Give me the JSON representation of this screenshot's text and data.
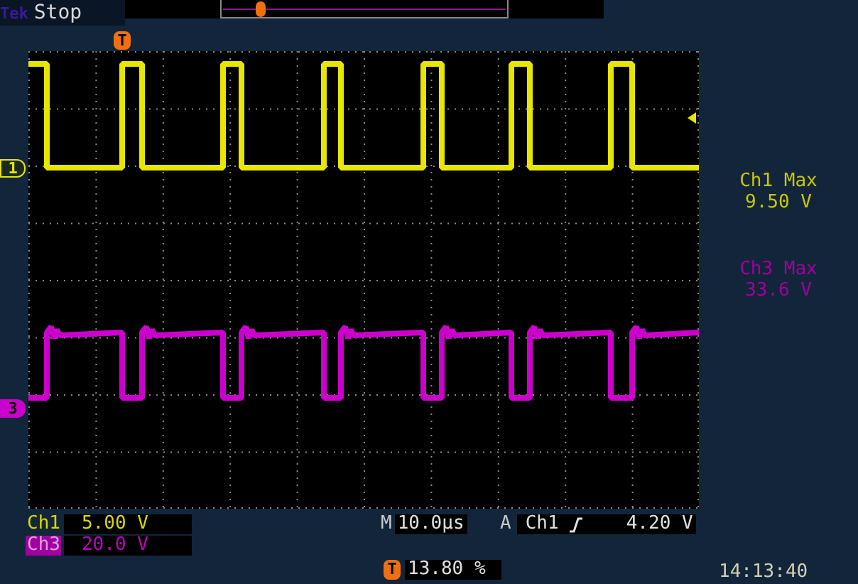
{
  "header": {
    "logo": "Tek",
    "status": "Stop"
  },
  "trigger_marker": "T",
  "channel_markers": [
    {
      "label": "1",
      "color": "#e6e600"
    },
    {
      "label": "3",
      "color": "#cc00cc"
    }
  ],
  "measurements": [
    {
      "label": "Ch1 Max",
      "value": "9.50 V",
      "color": "#c8c800"
    },
    {
      "label": "Ch3 Max",
      "value": "33.6 V",
      "color": "#a000a0"
    }
  ],
  "channel_settings": [
    {
      "label": "Ch1",
      "scale": "5.00 V",
      "selected": false
    },
    {
      "label": "Ch3",
      "scale": "20.0 V",
      "selected": true
    }
  ],
  "timebase": {
    "prefix": "M",
    "value": "10.0µs"
  },
  "trigger": {
    "prefix": "A",
    "source": "Ch1",
    "level": "4.20 V"
  },
  "trigger_position": {
    "marker": "T",
    "value": "13.80 %"
  },
  "clock": {
    "time": "14:13:40"
  }
}
